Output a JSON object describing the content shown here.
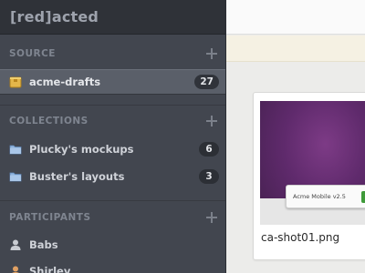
{
  "app": {
    "title": "[red]acted"
  },
  "sidebar": {
    "source": {
      "heading": "SOURCE",
      "items": [
        {
          "label": "acme-drafts",
          "count": "27",
          "icon": "package-icon",
          "active": true
        }
      ]
    },
    "collections": {
      "heading": "COLLECTIONS",
      "items": [
        {
          "label": "Plucky's mockups",
          "count": "6",
          "icon": "folder-icon"
        },
        {
          "label": "Buster's layouts",
          "count": "3",
          "icon": "folder-icon"
        }
      ]
    },
    "participants": {
      "heading": "PARTICIPANTS",
      "items": [
        {
          "label": "Babs",
          "icon": "user-icon"
        },
        {
          "label": "Shirley",
          "icon": "user-icon"
        }
      ]
    }
  },
  "main": {
    "card": {
      "caption": "ca-shot01.png",
      "thumbnail": {
        "toolbar_text": "Acme Mobile v2.5"
      }
    }
  },
  "colors": {
    "sidebar_bg": "#42464f",
    "header_bg": "#2f3238",
    "active_row": "#5a5f69",
    "folder_blue": "#8fb3dd",
    "package_gold": "#e3b64a",
    "thumb_purple": "#5f2a6c"
  }
}
